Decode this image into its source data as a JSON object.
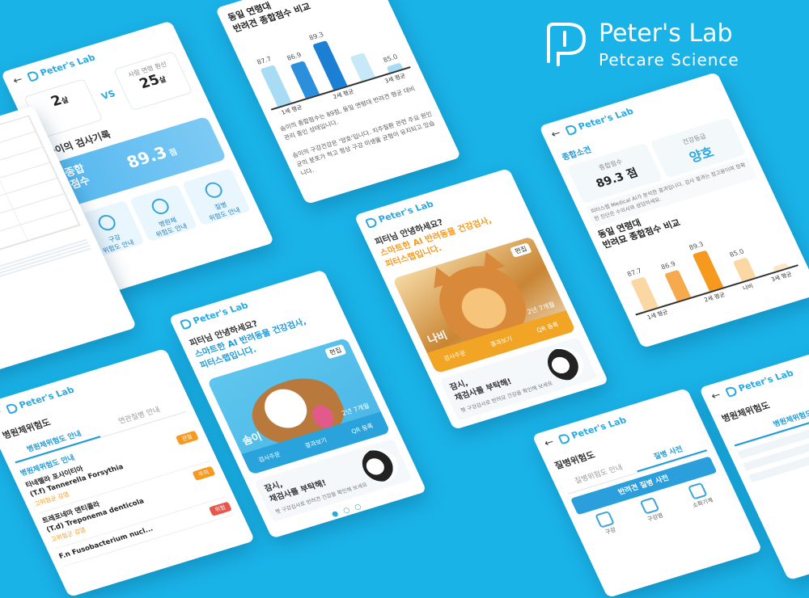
{
  "brand": {
    "name": "Peter's Lab",
    "tagline": "Petcare Science",
    "color": "#ffffff",
    "background": "#1ab3e8"
  },
  "app_label": "Peter's Lab",
  "card_score": {
    "vs": "VS",
    "pet_age_value": "2",
    "pet_age_unit": "살",
    "human_age_label": "사람 연령 환산",
    "human_age_value": "25",
    "human_age_unit": "살",
    "records_title": "솜이의 검사기록",
    "score_label_1": "종합",
    "score_label_2": "점수",
    "score_value": "89.3",
    "score_unit": "점",
    "tiles": [
      {
        "label": "구강\n위험도 안내",
        "icon": "tooth-icon"
      },
      {
        "label": "병원체\n위험도 안내",
        "icon": "bacteria-icon"
      },
      {
        "label": "질병\n위험도 안내",
        "icon": "virus-icon"
      }
    ]
  },
  "card_blue_chart": {
    "title": "동일 연령대\n반려견 종합점수 비교",
    "chart_data": {
      "type": "bar",
      "categories": [
        "1세 평균",
        "",
        "2세 평균",
        "",
        "3세 평균"
      ],
      "values": [
        87.7,
        86.9,
        89.3,
        85.0,
        0
      ],
      "value_labels": [
        "87.7",
        "86.9",
        "89.3",
        "",
        "85.0"
      ],
      "colors": [
        "#a8dcf5",
        "#2b8fdb",
        "#1b7fd3",
        "#c6e8f7",
        "#a8dcf5"
      ]
    },
    "para_1": "솜이의 종합점수는 89점, 동일 연령대 반려견 평균 대비 관리 중인 상태입니다.",
    "para_2": "솜이의 구강건강은 '양호'입니다. 치주질환 관련 주요 원인균의 분포가 적고 정상 구강 미생물 균형이 유지되고 있습니다."
  },
  "card_intro_dog": {
    "greeting": "피터님 안녕하세요?",
    "headline_1": "스마트한 AI 반려동물 건강검사,",
    "headline_2": "피터스랩입니다.",
    "edit_label": "편집",
    "pet_name": "솜이",
    "pet_age": "2년 7개월",
    "actions": [
      "검사주문",
      "결과보기",
      "QR 등록"
    ],
    "promo_title": "잠시,\n채검사를 부탁해!",
    "promo_sub": "펫 구강검사로 반려견 건강을 확인해 보세요"
  },
  "card_intro_cat": {
    "greeting": "피터님 안녕하세요?",
    "headline_1": "스마트한 AI 반려동물 건강검사,",
    "headline_2": "피터스랩입니다.",
    "edit_label": "편집",
    "pet_name": "나비",
    "pet_age": "2년 7개월",
    "actions": [
      "검사주문",
      "결과보기",
      "QR 등록"
    ],
    "promo_title": "잠시,\n채검사를 부탁해!",
    "promo_sub": "펫 구강검사로 반려묘 건강을 확인해 보세요"
  },
  "card_orange_chart": {
    "summary_title": "종합소견",
    "score_label": "종합점수",
    "score_value": "89.3 점",
    "status_label": "건강등급",
    "status_value": "양호",
    "note": "피터스랩 Medical AI가 분석한 결과입니다. 검사 결과는 참고용이며 정확한 진단은 수의사와 상담하세요.",
    "chart_title": "동일 연령대\n반려묘 종합점수 비교",
    "chart_data": {
      "type": "bar",
      "categories": [
        "1세 평균",
        "",
        "2세 평균",
        "나비",
        "3세 평균"
      ],
      "values": [
        87.7,
        86.9,
        89.3,
        85.0,
        0
      ],
      "value_labels": [
        "87.7",
        "86.9",
        "89.3",
        "85.0",
        ""
      ],
      "colors": [
        "#fbd7a4",
        "#f6a94d",
        "#f59a1e",
        "#fbd7a4",
        "#fbe6c6"
      ]
    }
  },
  "card_diseases": {
    "title": "병원체위험도",
    "tabs": [
      "병원체위험도 안내",
      "연관질병 안내"
    ],
    "section": "병원체위험도 안내",
    "items": [
      {
        "name": "타네렐라 포사이티아\n(T.f) Tannerella Forsythia",
        "sub": "고위험균 감염",
        "badge": "관찰",
        "badge_color": "#f59a1e"
      },
      {
        "name": "트레포네마 덴티콜라\n(T.d) Treponema denticola",
        "sub": "고위험군 감염",
        "badge": "주의",
        "badge_color": "#f59a1e"
      },
      {
        "name": "F.n Fusobacterium nucl...",
        "sub": "",
        "badge": "위험",
        "badge_color": "#e8574e"
      }
    ]
  },
  "card_dictionary": {
    "title": "질병위험도",
    "tabs": [
      "질병위험도 안내",
      "질병 사전"
    ],
    "banner": "반려견 질병 사전",
    "icons": [
      {
        "label": "구강",
        "icon": "tooth-icon"
      },
      {
        "label": "구강염",
        "icon": "mouth-icon"
      },
      {
        "label": "소화기계",
        "icon": "stomach-icon"
      }
    ]
  },
  "card_edge_right": {
    "title": "병원체위험도",
    "tabs": [
      "병원체위험도 안내"
    ]
  }
}
